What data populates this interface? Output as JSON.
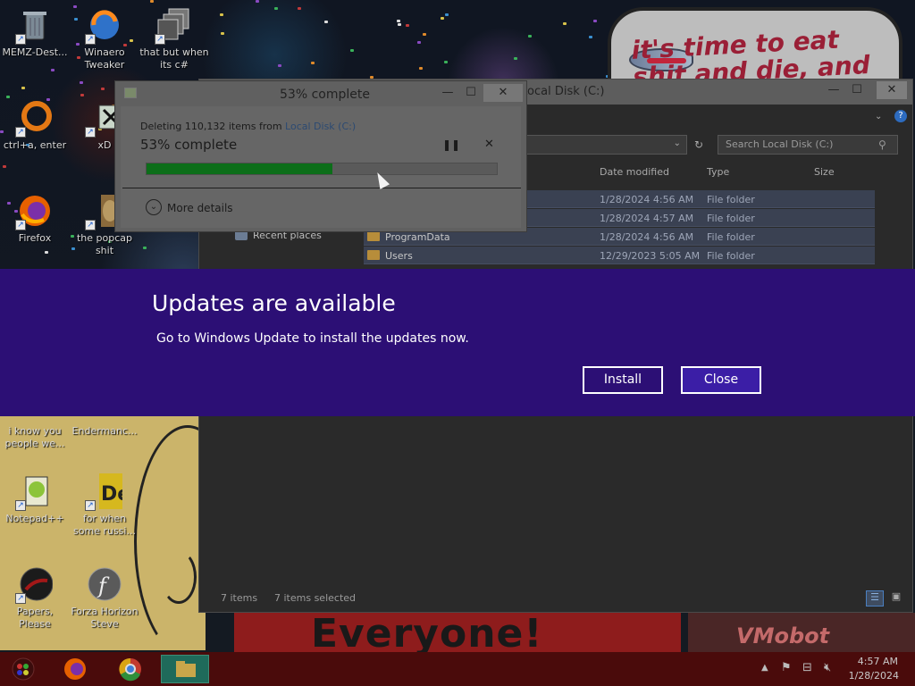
{
  "wallpaper": {
    "meme_text": "it's time to eat shit and die, and celebrate",
    "poster_text": "Everyone!",
    "right_poster_text": "VMobot"
  },
  "desktop_icons": [
    {
      "label": "MEMZ-Dest...",
      "icon": "trash-icon"
    },
    {
      "label": "Winaero Tweaker",
      "icon": "winaero-icon"
    },
    {
      "label": "that but when its c#",
      "icon": "stack-icon"
    },
    {
      "label": "ctrl+a, enter",
      "icon": "ring-icon"
    },
    {
      "label": "xD",
      "icon": "xd-icon"
    },
    {
      "label": "Firefox",
      "icon": "firefox-icon"
    },
    {
      "label": "the popcap shit",
      "icon": "popcap-icon"
    },
    {
      "label": "i know you people we...",
      "icon": "comic-icon"
    },
    {
      "label": "Endermanc...",
      "icon": "enderman-icon"
    },
    {
      "label": "Notepad++",
      "icon": "notepad-icon"
    },
    {
      "label": "for when some russi...",
      "icon": "de-icon"
    },
    {
      "label": "Papers, Please",
      "icon": "papers-icon"
    },
    {
      "label": "Forza Horizon Steve",
      "icon": "flash-icon"
    }
  ],
  "explorer": {
    "title": "Local Disk (C:)",
    "search_placeholder": "Search Local Disk (C:)",
    "columns": {
      "date": "Date modified",
      "type": "Type",
      "size": "Size"
    },
    "nav_recent": "Recent places",
    "rows": [
      {
        "name": "",
        "date": "1/28/2024 4:56 AM",
        "type": "File folder"
      },
      {
        "name": "",
        "date": "1/28/2024 4:57 AM",
        "type": "File folder"
      },
      {
        "name": "ProgramData",
        "date": "1/28/2024 4:56 AM",
        "type": "File folder"
      },
      {
        "name": "Users",
        "date": "12/29/2023 5:05 AM",
        "type": "File folder"
      }
    ],
    "status_items": "7 items",
    "status_selected": "7 items selected"
  },
  "progress_dialog": {
    "title": "53% complete",
    "status_prefix": "Deleting 110,132 items from ",
    "status_location": "Local Disk (C:)",
    "percent_text": "53% complete",
    "percent_value": 53,
    "more_details": "More details",
    "fill_color": "#0c6e19"
  },
  "update_banner": {
    "title": "Updates are available",
    "message": "Go to Windows Update to install the updates now.",
    "install_label": "Install",
    "close_label": "Close",
    "background_color": "#2c0f75"
  },
  "taskbar": {
    "apps": [
      "start-orb-icon",
      "firefox-icon",
      "chrome-icon",
      "file-explorer-icon"
    ],
    "clock_time": "4:57 AM",
    "clock_date": "1/28/2024"
  }
}
